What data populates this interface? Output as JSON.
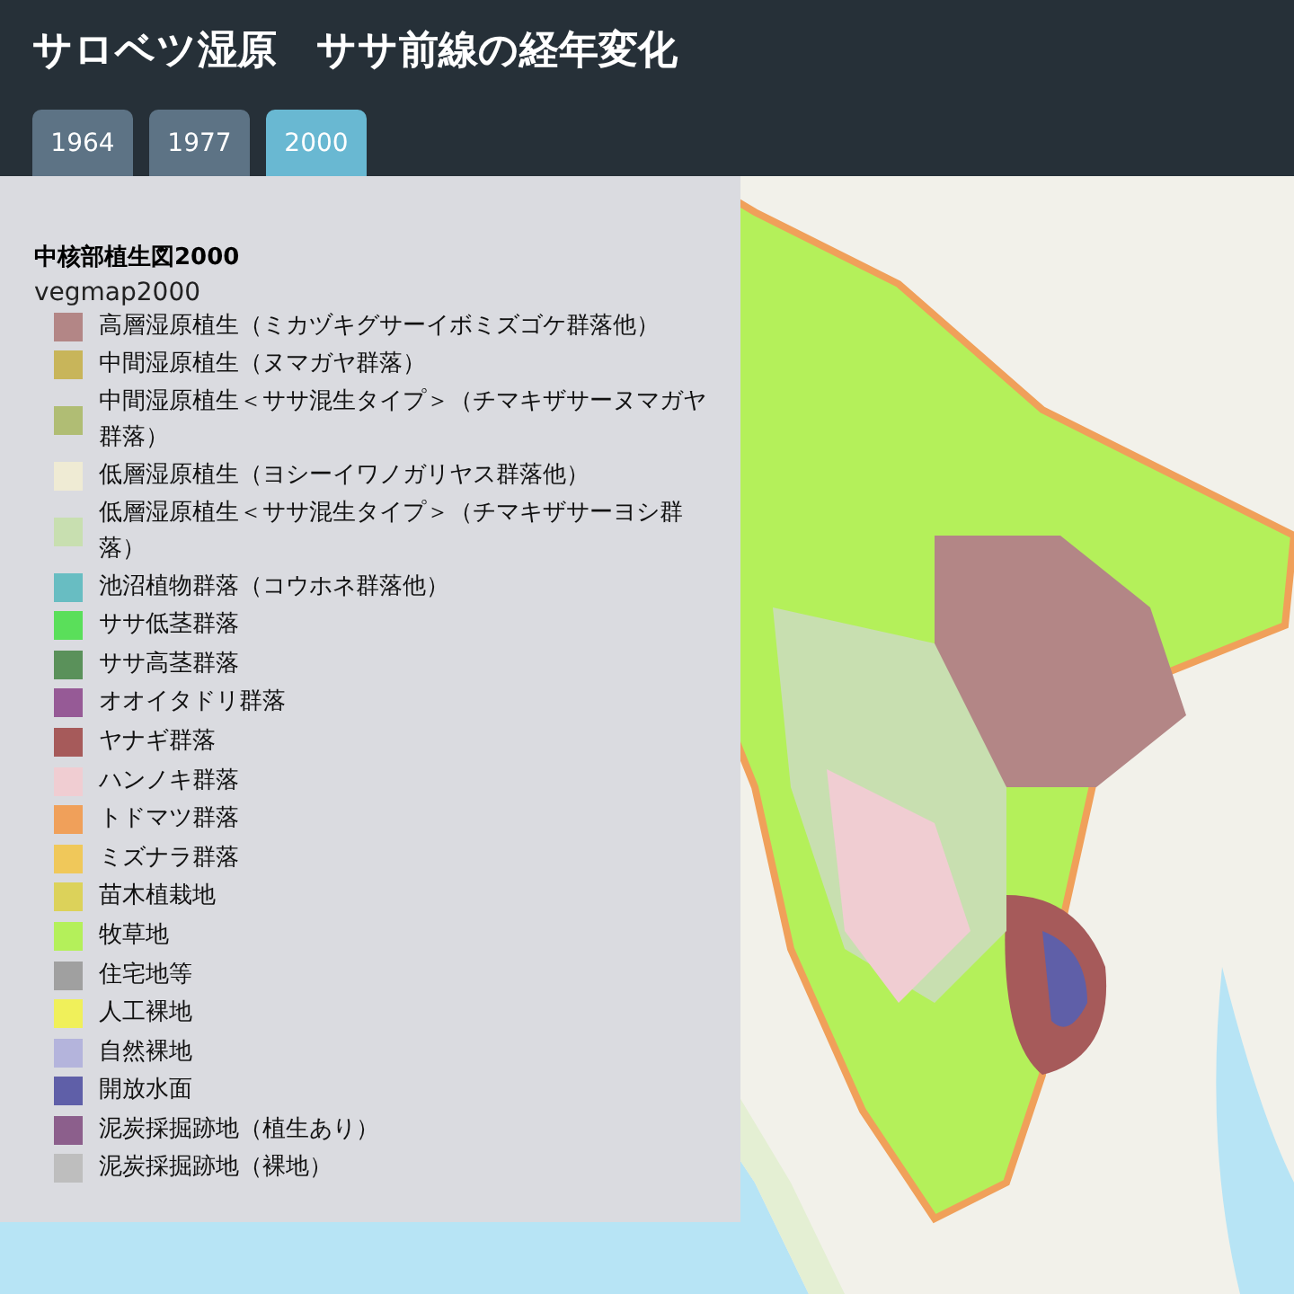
{
  "header": {
    "title": "サロベツ湿原　ササ前線の経年変化"
  },
  "tabs": [
    {
      "label": "1964",
      "selected": false
    },
    {
      "label": "1977",
      "selected": false
    },
    {
      "label": "2000",
      "selected": true
    }
  ],
  "legend": {
    "title": "中核部植生図2000",
    "layer": "vegmap2000",
    "items": [
      {
        "label": "高層湿原植生（ミカヅキグサーイボミズゴケ群落他）",
        "color": "#b38686"
      },
      {
        "label": "中間湿原植生（ヌマガヤ群落）",
        "color": "#c8b55a"
      },
      {
        "label": "中間湿原植生＜ササ混生タイプ＞（チマキザサーヌマガヤ群落）",
        "color": "#b0bd74"
      },
      {
        "label": "低層湿原植生（ヨシーイワノガリヤス群落他）",
        "color": "#efebd4"
      },
      {
        "label": "低層湿原植生＜ササ混生タイプ＞（チマキザサーヨシ群落）",
        "color": "#c8dfb0"
      },
      {
        "label": "池沼植物群落（コウホネ群落他）",
        "color": "#68bdc2"
      },
      {
        "label": "ササ低茎群落",
        "color": "#5adf5a"
      },
      {
        "label": "ササ高茎群落",
        "color": "#5a915a"
      },
      {
        "label": "オオイタドリ群落",
        "color": "#965a96"
      },
      {
        "label": "ヤナギ群落",
        "color": "#a65a5a"
      },
      {
        "label": "ハンノキ群落",
        "color": "#f0cdd2"
      },
      {
        "label": "トドマツ群落",
        "color": "#f0a05a"
      },
      {
        "label": "ミズナラ群落",
        "color": "#f0c85a"
      },
      {
        "label": "苗木植栽地",
        "color": "#dcd25a"
      },
      {
        "label": "牧草地",
        "color": "#b4f05a"
      },
      {
        "label": "住宅地等",
        "color": "#a0a0a0"
      },
      {
        "label": "人工裸地",
        "color": "#f0f05a"
      },
      {
        "label": "自然裸地",
        "color": "#b4b4dc"
      },
      {
        "label": "開放水面",
        "color": "#5f5fa8"
      },
      {
        "label": "泥炭採掘跡地（植生あり）",
        "color": "#8c5f8c"
      },
      {
        "label": "泥炭採掘跡地（裸地）",
        "color": "#bebebe"
      }
    ]
  }
}
